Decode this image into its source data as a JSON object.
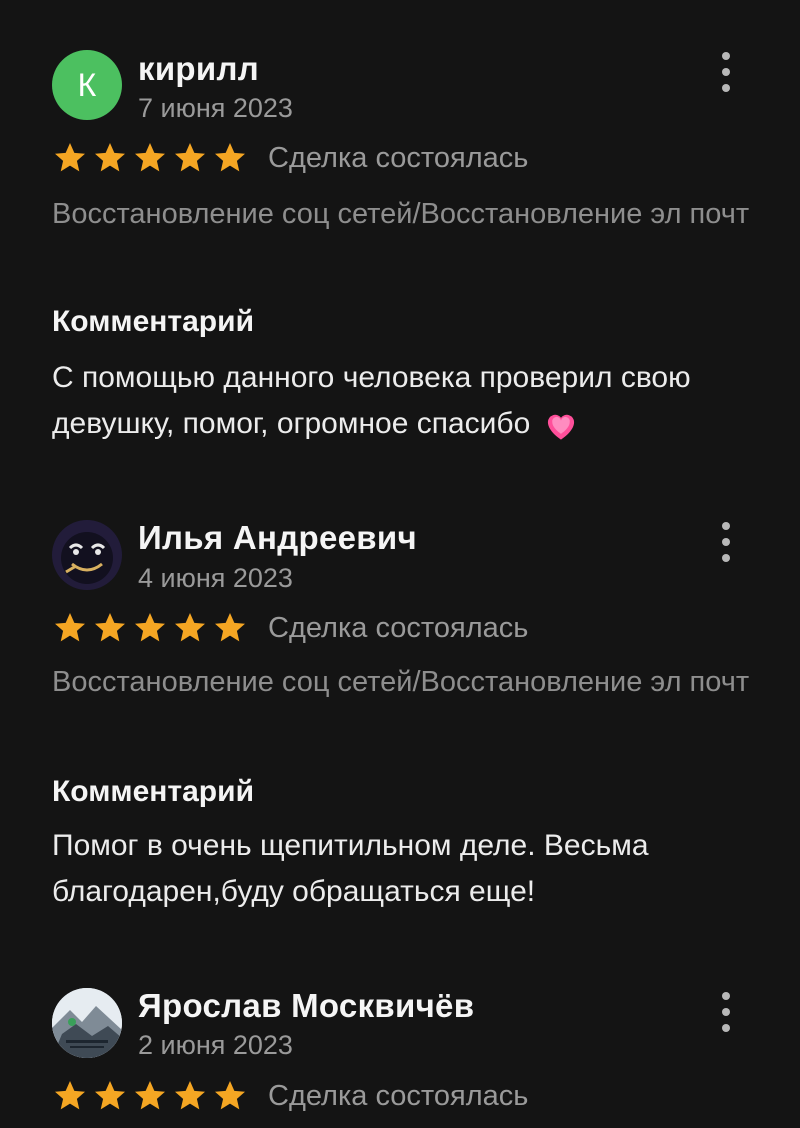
{
  "section_label": "Комментарий",
  "deal_status": "Сделка состоялась",
  "reviews": [
    {
      "avatar_letter": "К",
      "author": "кирилл",
      "date": "7 июня 2023",
      "rating": 5,
      "category": "Восстановление соц сетей/Восстановление эл почт",
      "comment": "С помощью данного человека проверил свою девушку, помог, огромное спасибо",
      "emoji": "pink-heart-icon"
    },
    {
      "avatar_letter": "",
      "author": "Илья Андреевич",
      "date": "4 июня 2023",
      "rating": 5,
      "category": "Восстановление соц сетей/Восстановление эл почт",
      "comment": "Помог в очень щепитильном деле. Весьма благодарен,буду обращаться еще!"
    },
    {
      "avatar_letter": "",
      "author": "Ярослав Москвичёв",
      "date": "2 июня 2023",
      "rating": 5
    }
  ],
  "colors": {
    "background": "#141414",
    "star": "#f5a623",
    "avatar_green": "#4cc060",
    "muted_text": "#9a9a9a"
  }
}
